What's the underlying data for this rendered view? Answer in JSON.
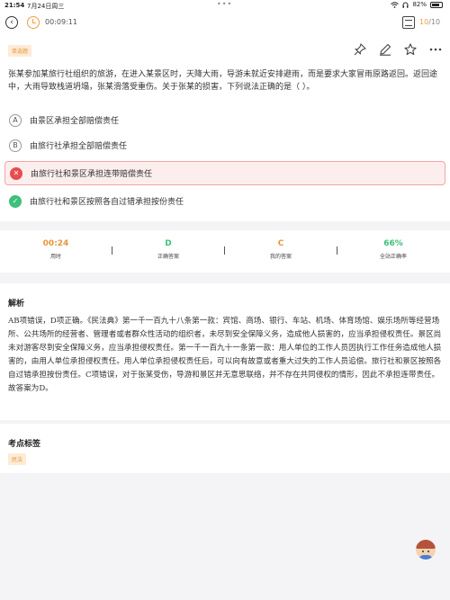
{
  "status": {
    "time": "21:54",
    "date": "7月24日周三",
    "battery": "82%",
    "battery_level": 0.82
  },
  "topbar": {
    "timer": "00:09:11",
    "progress_current": "10",
    "progress_sep": "/",
    "progress_total": "10"
  },
  "question": {
    "type_tag": "单选题",
    "text": "张某参加某旅行社组织的旅游，在进入某景区时，天降大雨，导游未就近安排避雨，而是要求大家冒雨原路返回。返回途中，大雨导致栈道坍塌，张某滑落受重伤。关于张某的损害，下列说法正确的是（ ）。",
    "options": [
      {
        "letter": "A",
        "text": "由景区承担全部赔偿责任",
        "state": "normal"
      },
      {
        "letter": "B",
        "text": "由旅行社承担全部赔偿责任",
        "state": "normal"
      },
      {
        "letter": "C",
        "text": "由旅行社和景区承担连带赔偿责任",
        "state": "wrong"
      },
      {
        "letter": "D",
        "text": "由旅行社和景区按照各自过错承担按份责任",
        "state": "right"
      }
    ]
  },
  "stats": {
    "time_used": {
      "value": "00:24",
      "label": "用时"
    },
    "correct_answer": {
      "value": "D",
      "label": "正确答案"
    },
    "my_answer": {
      "value": "C",
      "label": "我的答案"
    },
    "site_accuracy": {
      "value": "66%",
      "label": "全站正确率"
    }
  },
  "analysis": {
    "title": "解析",
    "text": "AB项错误，D项正确。《民法典》第一千一百九十八条第一款：宾馆、商场、银行、车站、机场、体育场馆、娱乐场所等经营场所、公共场所的经营者、管理者或者群众性活动的组织者，未尽到安全保障义务，造成他人损害的，应当承担侵权责任。景区尚未对游客尽到安全保障义务，应当承担侵权责任。第一千一百九十一条第一款：用人单位的工作人员因执行工作任务造成他人损害的，由用人单位承担侵权责任。用人单位承担侵权责任后，可以向有故意或者重大过失的工作人员追偿。旅行社和景区按照各自过错承担按份责任。C项错误，对于张某受伤，导游和景区并无意思联络，并不存在共同侵权的情形，因此不承担连带责任。故答案为D。"
  },
  "points": {
    "title": "考点标签",
    "tags": [
      "民法"
    ]
  },
  "colors": {
    "accent": "#f0a040",
    "wrong": "#e94c4c",
    "right": "#3ec07a"
  },
  "icons": [
    "back-icon",
    "timer-icon",
    "answer-sheet-icon",
    "pin-icon",
    "edit-icon",
    "favorite-star-icon",
    "more-icon",
    "mascot-avatar"
  ]
}
